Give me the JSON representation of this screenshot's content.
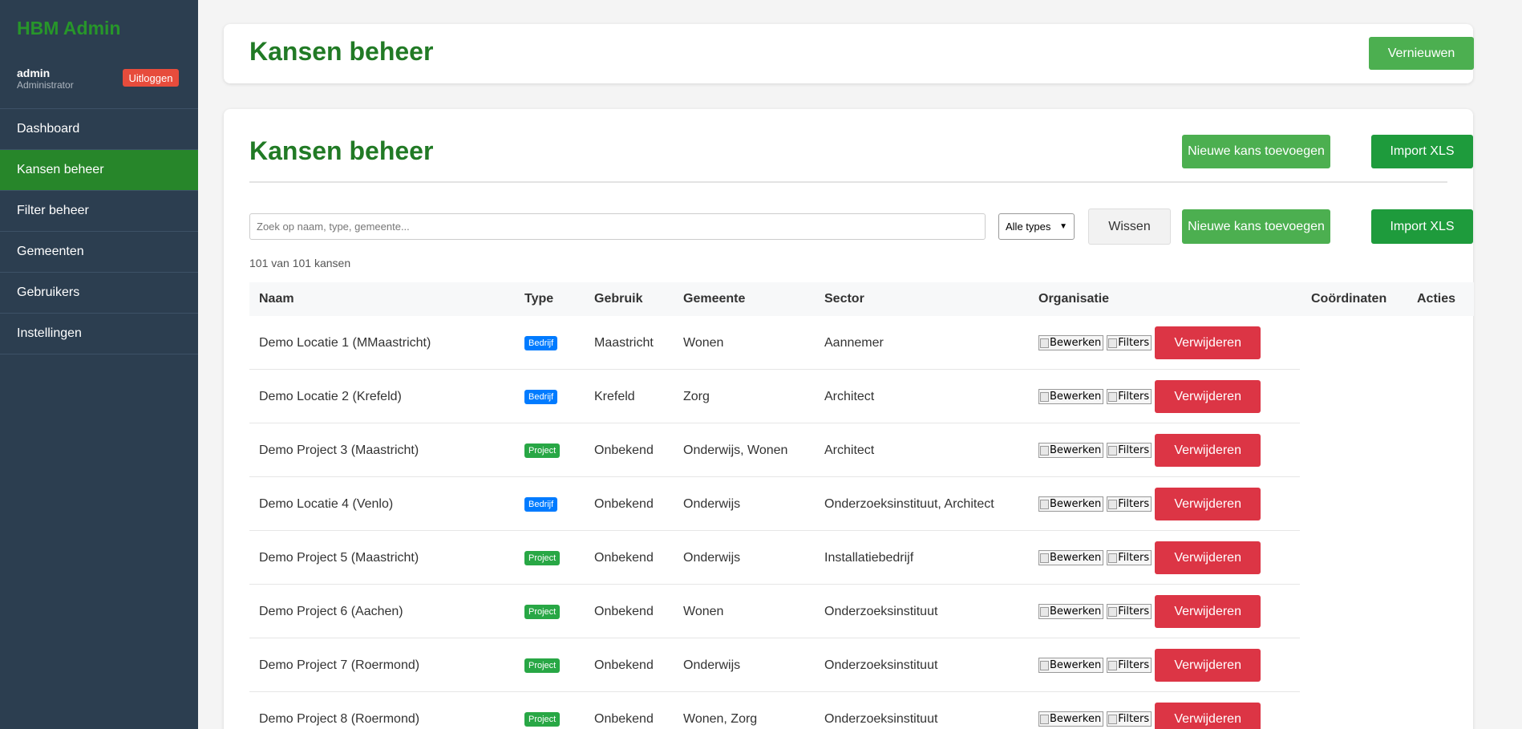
{
  "sidebar": {
    "brand": "HBM Admin",
    "user": {
      "name": "admin",
      "role": "Administrator"
    },
    "logout_label": "Uitloggen",
    "nav": [
      {
        "label": "Dashboard",
        "active": false
      },
      {
        "label": "Kansen beheer",
        "active": true
      },
      {
        "label": "Filter beheer",
        "active": false
      },
      {
        "label": "Gemeenten",
        "active": false
      },
      {
        "label": "Gebruikers",
        "active": false
      },
      {
        "label": "Instellingen",
        "active": false
      }
    ]
  },
  "header": {
    "title": "Kansen beheer",
    "refresh_label": "Vernieuwen"
  },
  "main": {
    "title": "Kansen beheer",
    "add_label": "Nieuwe kans toevoegen",
    "import_label": "Import XLS",
    "search_placeholder": "Zoek op naam, type, gemeente...",
    "type_select": "Alle types",
    "clear_label": "Wissen",
    "count_text": "101 van 101 kansen"
  },
  "table": {
    "columns": [
      "Naam",
      "Type",
      "Gebruik",
      "Gemeente",
      "Sector",
      "Organisatie",
      "Coördinaten",
      "Acties"
    ],
    "edit_alt": "Bewerken",
    "filters_alt": "Filters",
    "delete_label": "Verwijderen",
    "rows": [
      {
        "naam": "Demo Locatie 1 (MMaastricht)",
        "type": "Bedrijf",
        "gebruik": "Maastricht",
        "gemeente": "Wonen",
        "sector": "Aannemer"
      },
      {
        "naam": "Demo Locatie 2 (Krefeld)",
        "type": "Bedrijf",
        "gebruik": "Krefeld",
        "gemeente": "Zorg",
        "sector": "Architect"
      },
      {
        "naam": "Demo Project 3 (Maastricht)",
        "type": "Project",
        "gebruik": "Onbekend",
        "gemeente": "Onderwijs, Wonen",
        "sector": "Architect"
      },
      {
        "naam": "Demo Locatie 4 (Venlo)",
        "type": "Bedrijf",
        "gebruik": "Onbekend",
        "gemeente": "Onderwijs",
        "sector": "Onderzoeksinstituut, Architect"
      },
      {
        "naam": "Demo Project 5 (Maastricht)",
        "type": "Project",
        "gebruik": "Onbekend",
        "gemeente": "Onderwijs",
        "sector": "Installatiebedrijf"
      },
      {
        "naam": "Demo Project 6 (Aachen)",
        "type": "Project",
        "gebruik": "Onbekend",
        "gemeente": "Wonen",
        "sector": "Onderzoeksinstituut"
      },
      {
        "naam": "Demo Project 7 (Roermond)",
        "type": "Project",
        "gebruik": "Onbekend",
        "gemeente": "Onderwijs",
        "sector": "Onderzoeksinstituut"
      },
      {
        "naam": "Demo Project 8 (Roermond)",
        "type": "Project",
        "gebruik": "Onbekend",
        "gemeente": "Wonen, Zorg",
        "sector": "Onderzoeksinstituut"
      }
    ]
  }
}
